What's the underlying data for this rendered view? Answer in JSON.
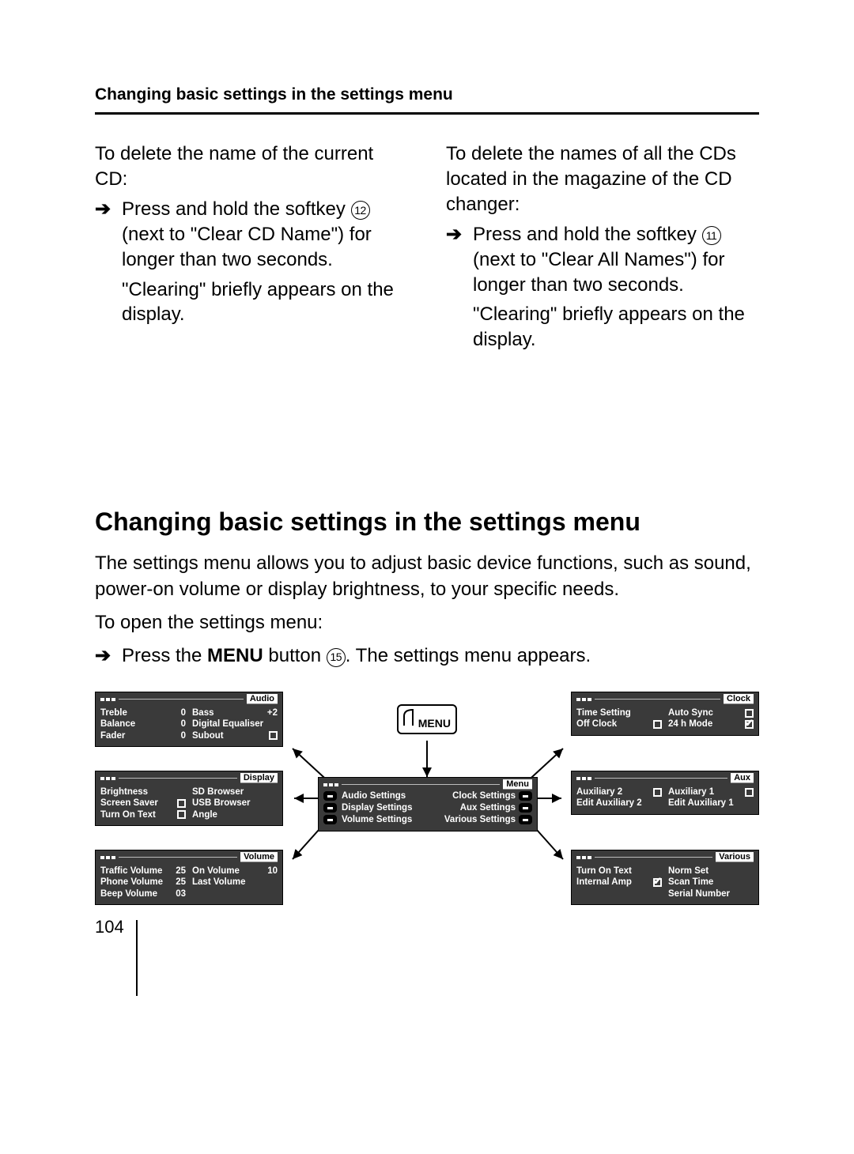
{
  "header": "Changing basic settings in the settings menu",
  "left": {
    "intro": "To delete the name of the current CD:",
    "step_pre": "Press and hold the softkey ",
    "soft_num": "12",
    "step_post": " (next to \"Clear CD Name\") for longer than two seconds.",
    "result": "\"Clearing\" briefly appears on the display."
  },
  "right": {
    "intro": "To delete the names of all the CDs located in the magazine of the CD changer:",
    "step_pre": "Press and hold the softkey ",
    "soft_num": "11",
    "step_post": " (next to \"Clear All Names\") for longer than two seconds.",
    "result": "\"Clearing\" briefly appears on the display."
  },
  "section_title": "Changing basic settings in the settings menu",
  "lead": "The settings menu allows you to adjust basic device functions, such as sound, power-on volume or display brightness, to your specific needs.",
  "open_line": "To open the settings menu:",
  "press_pre": "Press the ",
  "press_btn": "MENU",
  "press_mid": " button ",
  "press_num": "15",
  "press_post": ". The settings menu appears.",
  "menu_button": "MENU",
  "panel_audio": {
    "tag": "Audio",
    "left": [
      {
        "k": "Treble",
        "v": "0"
      },
      {
        "k": "Balance",
        "v": "0"
      },
      {
        "k": "Fader",
        "v": "0"
      }
    ],
    "right_bass_k": "Bass",
    "right_bass_v": "+2",
    "right_eq": "Digital Equaliser",
    "right_sub": "Subout"
  },
  "panel_display": {
    "tag": "Display",
    "l1": "Brightness",
    "l2": "Screen Saver",
    "l3": "Turn On Text",
    "r1": "SD Browser",
    "r2": "USB Browser",
    "r3": "Angle"
  },
  "panel_volume": {
    "tag": "Volume",
    "l": [
      {
        "k": "Traffic Volume",
        "v": "25"
      },
      {
        "k": "Phone Volume",
        "v": "25"
      },
      {
        "k": "Beep Volume",
        "v": "03"
      }
    ],
    "r_on_k": "On Volume",
    "r_on_v": "10",
    "r_last": "Last Volume"
  },
  "panel_menu": {
    "tag": "Menu",
    "l1": "Audio   Settings",
    "r1": "Clock Settings",
    "l2": "Display Settings",
    "r2": "Aux Settings",
    "l3": "Volume Settings",
    "r3": "Various Settings"
  },
  "panel_clock": {
    "tag": "Clock",
    "l1": "Time Setting",
    "l2": "Off Clock",
    "r1": "Auto Sync",
    "r2": "24 h Mode"
  },
  "panel_aux": {
    "tag": "Aux",
    "l1": "Auxiliary 2",
    "l2": "Edit Auxiliary 2",
    "r1": "Auxiliary 1",
    "r2": "Edit Auxiliary 1"
  },
  "panel_various": {
    "tag": "Various",
    "l1": "Turn On Text",
    "l2": "Internal Amp",
    "r1": "Norm Set",
    "r2": "Scan Time",
    "r3": "Serial Number"
  },
  "page_number": "104"
}
